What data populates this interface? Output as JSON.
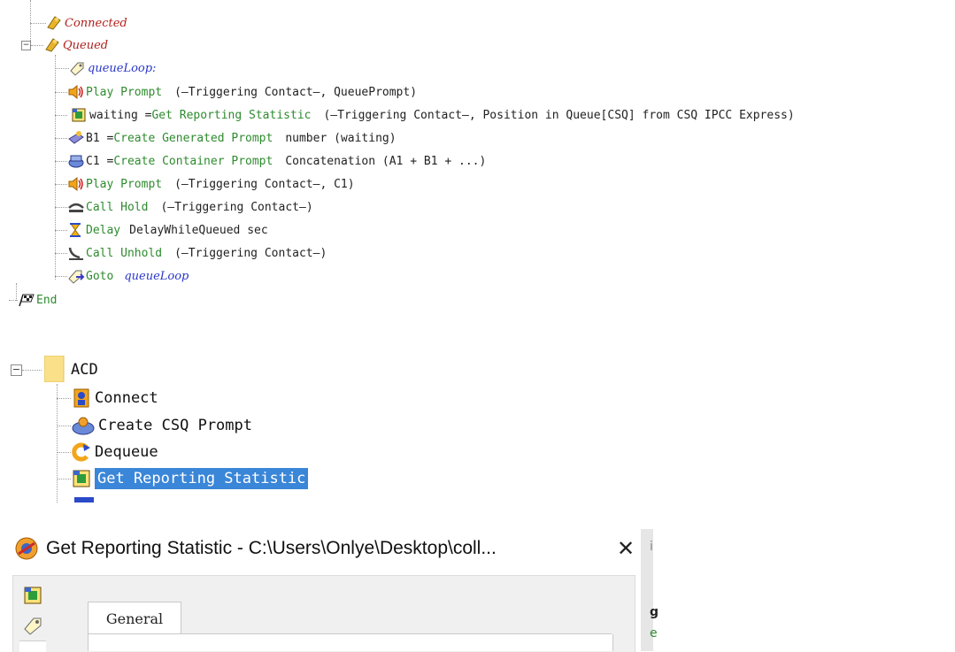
{
  "script_tree": {
    "nodes": [
      {
        "icon": "connected-icon",
        "label": "Connected"
      },
      {
        "icon": "queued-icon",
        "label": "Queued",
        "expander": "−"
      },
      {
        "icon": "label-tag-icon",
        "label": "queueLoop:"
      },
      {
        "icon": "speaker-icon",
        "pre": "Play Prompt",
        "args": "(—Triggering Contact—, QueuePrompt)"
      },
      {
        "icon": "reporting-stat-icon",
        "pre": "waiting = ",
        "fn": "Get Reporting Statistic",
        "args": "(—Triggering Contact—, Position in Queue[CSQ] from CSQ IPCC Express)"
      },
      {
        "icon": "generated-prompt-icon",
        "pre": "B1 = ",
        "fn": "Create Generated Prompt",
        "args": "number (waiting)"
      },
      {
        "icon": "container-prompt-icon",
        "pre": "C1 = ",
        "fn": "Create Container Prompt",
        "args": "Concatenation (A1 + B1 + ...)"
      },
      {
        "icon": "speaker-icon",
        "pre": "Play Prompt",
        "args": "(—Triggering Contact—, C1)"
      },
      {
        "icon": "call-hold-icon",
        "pre": "Call Hold",
        "args": "(—Triggering Contact—)"
      },
      {
        "icon": "hourglass-icon",
        "pre": "Delay",
        "args": "DelayWhileQueued sec"
      },
      {
        "icon": "call-unhold-icon",
        "pre": "Call Unhold",
        "args": "(—Triggering Contact—)"
      },
      {
        "icon": "goto-icon",
        "pre": "Goto",
        "target": "queueLoop"
      },
      {
        "icon": "checkered-flag-icon",
        "pre": "End"
      }
    ]
  },
  "palette_tree": {
    "folder": "ACD",
    "expander": "−",
    "items": [
      {
        "icon": "connect-icon",
        "label": "Connect"
      },
      {
        "icon": "create-csq-prompt-icon",
        "label": "Create CSQ Prompt"
      },
      {
        "icon": "dequeue-icon",
        "label": "Dequeue"
      },
      {
        "icon": "reporting-stat-icon",
        "label": "Get Reporting Statistic",
        "selected": true
      }
    ]
  },
  "dialog": {
    "title": "Get Reporting Statistic - C:\\Users\\Onlye\\Desktop\\coll...",
    "close_label": "✕",
    "tab_general": "General",
    "right_fragments": [
      "i",
      "g",
      "e"
    ]
  },
  "colors": {
    "selection": "#3a86d8",
    "step_green": "#2e8b2e",
    "label_blue": "#2a36c8",
    "state_red": "#b0201c"
  }
}
